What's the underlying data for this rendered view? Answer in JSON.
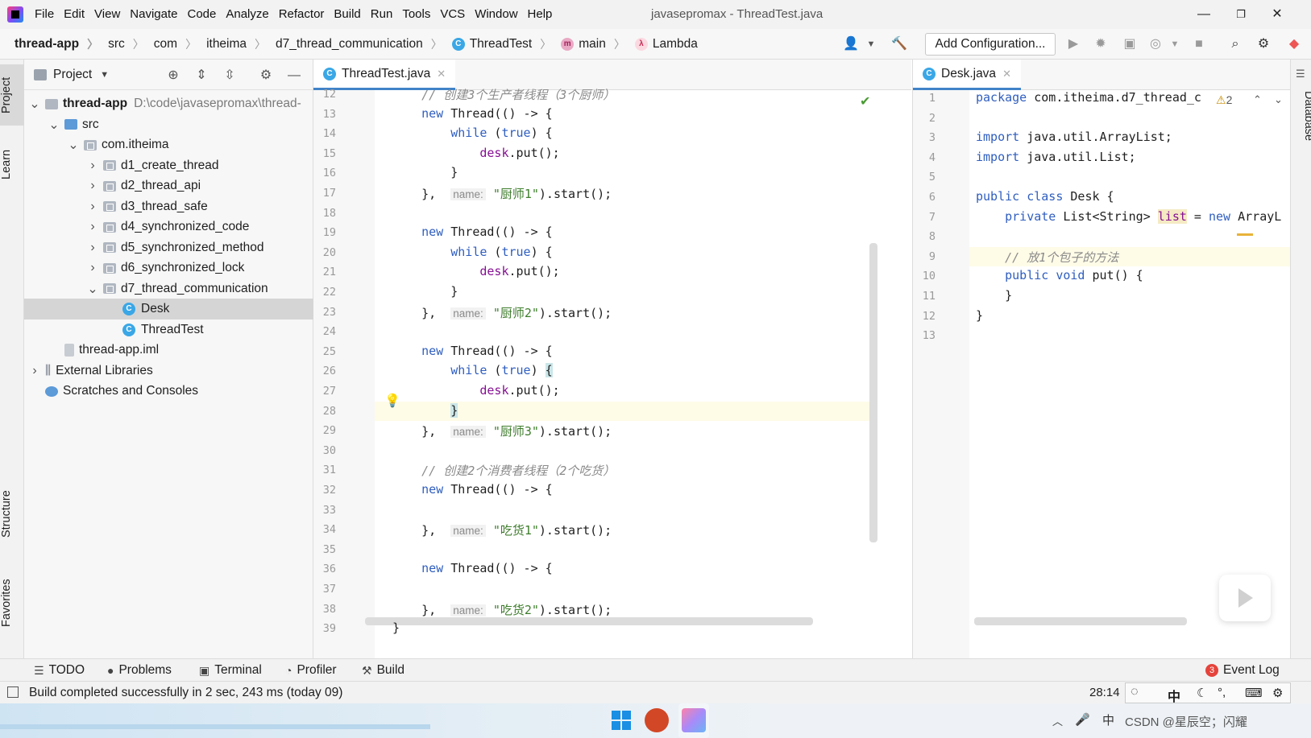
{
  "window": {
    "title": "javasepromax - ThreadTest.java",
    "menu": [
      "File",
      "Edit",
      "View",
      "Navigate",
      "Code",
      "Analyze",
      "Refactor",
      "Build",
      "Run",
      "Tools",
      "VCS",
      "Window",
      "Help"
    ],
    "menu_underline": [
      "F",
      "E",
      "V",
      "N",
      "C",
      "z",
      "R",
      "B",
      "u",
      "T",
      "S",
      "W",
      "H"
    ]
  },
  "breadcrumb": {
    "project": "thread-app",
    "items": [
      "src",
      "com",
      "itheima",
      "d7_thread_communication",
      "ThreadTest",
      "main",
      "Lambda"
    ]
  },
  "toolbar": {
    "add_configuration": "Add Configuration..."
  },
  "left_tabs": {
    "project": "Project",
    "learn": "Learn",
    "structure": "Structure",
    "favorites": "Favorites"
  },
  "right_tabs": {
    "database": "Database"
  },
  "project_panel": {
    "title": "Project",
    "tree": [
      {
        "label": "thread-app",
        "extra": "D:\\code\\javasepromax\\thread-",
        "level": 0,
        "arrow": "down",
        "type": "module"
      },
      {
        "label": "src",
        "level": 1,
        "arrow": "down",
        "type": "srcfolder"
      },
      {
        "label": "com.itheima",
        "level": 2,
        "arrow": "down",
        "type": "package"
      },
      {
        "label": "d1_create_thread",
        "level": 3,
        "arrow": "right",
        "type": "package"
      },
      {
        "label": "d2_thread_api",
        "level": 3,
        "arrow": "right",
        "type": "package"
      },
      {
        "label": "d3_thread_safe",
        "level": 3,
        "arrow": "right",
        "type": "package"
      },
      {
        "label": "d4_synchronized_code",
        "level": 3,
        "arrow": "right",
        "type": "package"
      },
      {
        "label": "d5_synchronized_method",
        "level": 3,
        "arrow": "right",
        "type": "package"
      },
      {
        "label": "d6_synchronized_lock",
        "level": 3,
        "arrow": "right",
        "type": "package"
      },
      {
        "label": "d7_thread_communication",
        "level": 3,
        "arrow": "down",
        "type": "package"
      },
      {
        "label": "Desk",
        "level": 4,
        "arrow": "",
        "type": "class",
        "selected": true
      },
      {
        "label": "ThreadTest",
        "level": 4,
        "arrow": "",
        "type": "class"
      },
      {
        "label": "thread-app.iml",
        "level": 1,
        "arrow": "",
        "type": "iml"
      },
      {
        "label": "External Libraries",
        "level": 0,
        "arrow": "right",
        "type": "lib"
      },
      {
        "label": "Scratches and Consoles",
        "level": 0,
        "arrow": "",
        "type": "scratch"
      }
    ]
  },
  "editor_left": {
    "tab": "ThreadTest.java",
    "line_numbers": [
      "12",
      "13",
      "14",
      "15",
      "16",
      "17",
      "18",
      "19",
      "20",
      "21",
      "22",
      "23",
      "24",
      "25",
      "26",
      "27",
      "28",
      "29",
      "30",
      "31",
      "32",
      "33",
      "34",
      "35",
      "36",
      "37",
      "38",
      "39"
    ],
    "lines": [
      {
        "no": "12",
        "html": "<span class='cmt'>    // 创建3个生产者线程（3个厨师）</span>"
      },
      {
        "no": "13",
        "html": "    <span class='kw'>new</span> Thread(() -> {"
      },
      {
        "no": "14",
        "html": "        <span class='kw'>while</span> (<span class='kw'>true</span>) {"
      },
      {
        "no": "15",
        "html": "            <span class='fld'>desk</span>.put();"
      },
      {
        "no": "16",
        "html": "        }"
      },
      {
        "no": "17",
        "html": "    },  <span class='hint'>name:</span> <span class='str'>\"厨师1\"</span>).start();"
      },
      {
        "no": "18",
        "html": ""
      },
      {
        "no": "19",
        "html": "    <span class='kw'>new</span> Thread(() -> {"
      },
      {
        "no": "20",
        "html": "        <span class='kw'>while</span> (<span class='kw'>true</span>) {"
      },
      {
        "no": "21",
        "html": "            <span class='fld'>desk</span>.put();"
      },
      {
        "no": "22",
        "html": "        }"
      },
      {
        "no": "23",
        "html": "    },  <span class='hint'>name:</span> <span class='str'>\"厨师2\"</span>).start();"
      },
      {
        "no": "24",
        "html": ""
      },
      {
        "no": "25",
        "html": "    <span class='kw'>new</span> Thread(() -> {"
      },
      {
        "no": "26",
        "html": "        <span class='kw'>while</span> (<span class='kw'>true</span>) <span style='background:#cbe6e8'>{</span>"
      },
      {
        "no": "27",
        "html": "            <span class='fld'>desk</span>.put();"
      },
      {
        "no": "28",
        "html": "        <span style='background:#cbe6e8'>}</span>"
      },
      {
        "no": "29",
        "html": "    },  <span class='hint'>name:</span> <span class='str'>\"厨师3\"</span>).start();"
      },
      {
        "no": "30",
        "html": ""
      },
      {
        "no": "31",
        "html": "    <span class='cmt'>// 创建2个消费者线程（2个吃货）</span>"
      },
      {
        "no": "32",
        "html": "    <span class='kw'>new</span> Thread(() -> {"
      },
      {
        "no": "33",
        "html": ""
      },
      {
        "no": "34",
        "html": "    },  <span class='hint'>name:</span> <span class='str'>\"吃货1\"</span>).start();"
      },
      {
        "no": "35",
        "html": ""
      },
      {
        "no": "36",
        "html": "    <span class='kw'>new</span> Thread(() -> {"
      },
      {
        "no": "37",
        "html": ""
      },
      {
        "no": "38",
        "html": "    },  <span class='hint'>name:</span> <span class='str'>\"吃货2\"</span>).start();"
      },
      {
        "no": "39",
        "html": "}"
      }
    ]
  },
  "editor_right": {
    "tab": "Desk.java",
    "warnings": "2",
    "lines": [
      {
        "no": "1",
        "html": "<span class='kw'>package</span> com.itheima.d7_thread_c"
      },
      {
        "no": "2",
        "html": ""
      },
      {
        "no": "3",
        "html": "<span class='kw'>import</span> java.util.ArrayList;"
      },
      {
        "no": "4",
        "html": "<span class='kw'>import</span> java.util.List;"
      },
      {
        "no": "5",
        "html": ""
      },
      {
        "no": "6",
        "html": "<span class='kw'>public class</span> Desk {"
      },
      {
        "no": "7",
        "html": "    <span class='kw'>private</span> List&lt;String&gt; <span class='fld' style='background:#f5eac4'>list</span> = <span class='kw'>new</span> ArrayL"
      },
      {
        "no": "8",
        "html": ""
      },
      {
        "no": "9",
        "html": "    <span class='cmt'>// 放1个包子的方法</span>"
      },
      {
        "no": "10",
        "html": "    <span class='kw'>public void</span> put() {"
      },
      {
        "no": "11",
        "html": "    }"
      },
      {
        "no": "12",
        "html": "}"
      },
      {
        "no": "13",
        "html": ""
      }
    ]
  },
  "bottom_tools": {
    "todo": "TODO",
    "problems": "Problems",
    "terminal": "Terminal",
    "profiler": "Profiler",
    "build": "Build",
    "event_log": "Event Log",
    "event_count": "3"
  },
  "status": {
    "message": "Build completed successfully in 2 sec, 243 ms (today 09)",
    "position": "28:14",
    "ime": "中"
  },
  "taskbar": {
    "watermark": "CSDN @星辰空；闪耀"
  },
  "colors": {
    "accent": "#4083c9",
    "keyword": "#2f5ebf",
    "string": "#3e7d2c",
    "selection": "#d5d5d5"
  }
}
